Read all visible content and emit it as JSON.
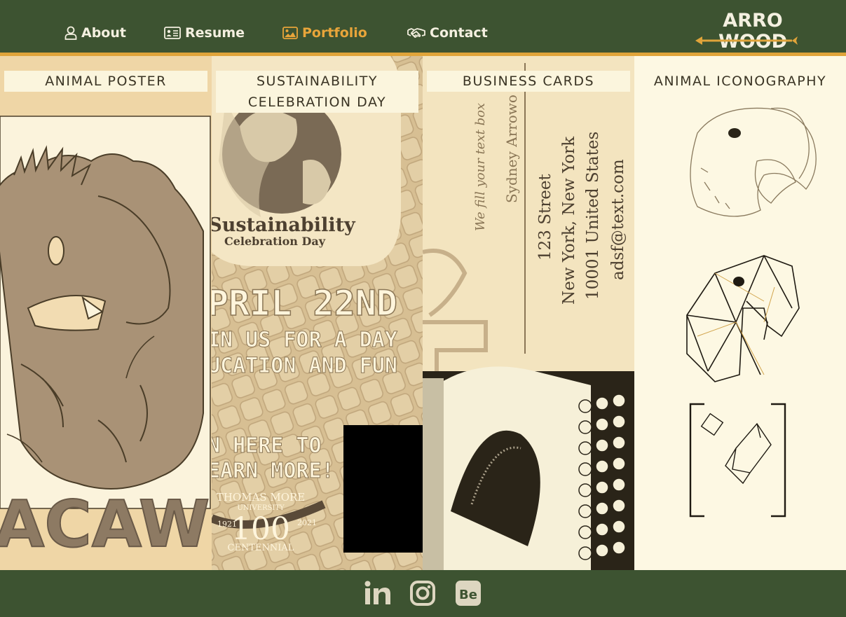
{
  "nav": {
    "items": [
      {
        "label": "About",
        "icon": "user-icon",
        "active": false
      },
      {
        "label": "Resume",
        "icon": "id-card-icon",
        "active": false
      },
      {
        "label": "Portfolio",
        "icon": "image-icon",
        "active": true
      },
      {
        "label": "Contact",
        "icon": "handshake-icon",
        "active": false
      }
    ]
  },
  "logo": {
    "line1": "ARRO",
    "line2": "WOOD"
  },
  "panels": [
    {
      "label": "ANIMAL POSTER",
      "art_text": "MACAW"
    },
    {
      "label_line1": "SUSTAINABILITY",
      "label_line2": "CELEBRATION DAY",
      "art": {
        "title": "Sustainability",
        "subtitle": "Celebration Day",
        "date": "PRIL 22ND",
        "line1": "IN US FOR A DAY",
        "line2": "UCATION AND FUN",
        "cta1": "N HERE TO",
        "cta2": "EARN MORE!",
        "org1": "THOMAS MORE",
        "org2": "UNIVERSITY",
        "org_num": "100",
        "org3": "CENTENNIAL",
        "year1": "1921",
        "year2": "2021"
      }
    },
    {
      "label": "BUSINESS CARDS",
      "art": {
        "tagline": "We fill your text box",
        "name": "Sydney Arrowo",
        "addr1": "123 Street",
        "addr2": "New York, New York",
        "addr3": "10001 United States",
        "email": "adsf@text.com"
      }
    },
    {
      "label": "ANIMAL ICONOGRAPHY"
    }
  ],
  "social": [
    {
      "name": "LinkedIn",
      "icon": "linkedin-icon",
      "text": "in"
    },
    {
      "name": "Instagram",
      "icon": "instagram-icon"
    },
    {
      "name": "Behance",
      "icon": "behance-icon",
      "text": "Be"
    }
  ],
  "colors": {
    "header": "#3d5331",
    "accent": "#e0a43a",
    "cream": "#fbf5dd",
    "text": "#f4f0e0"
  }
}
